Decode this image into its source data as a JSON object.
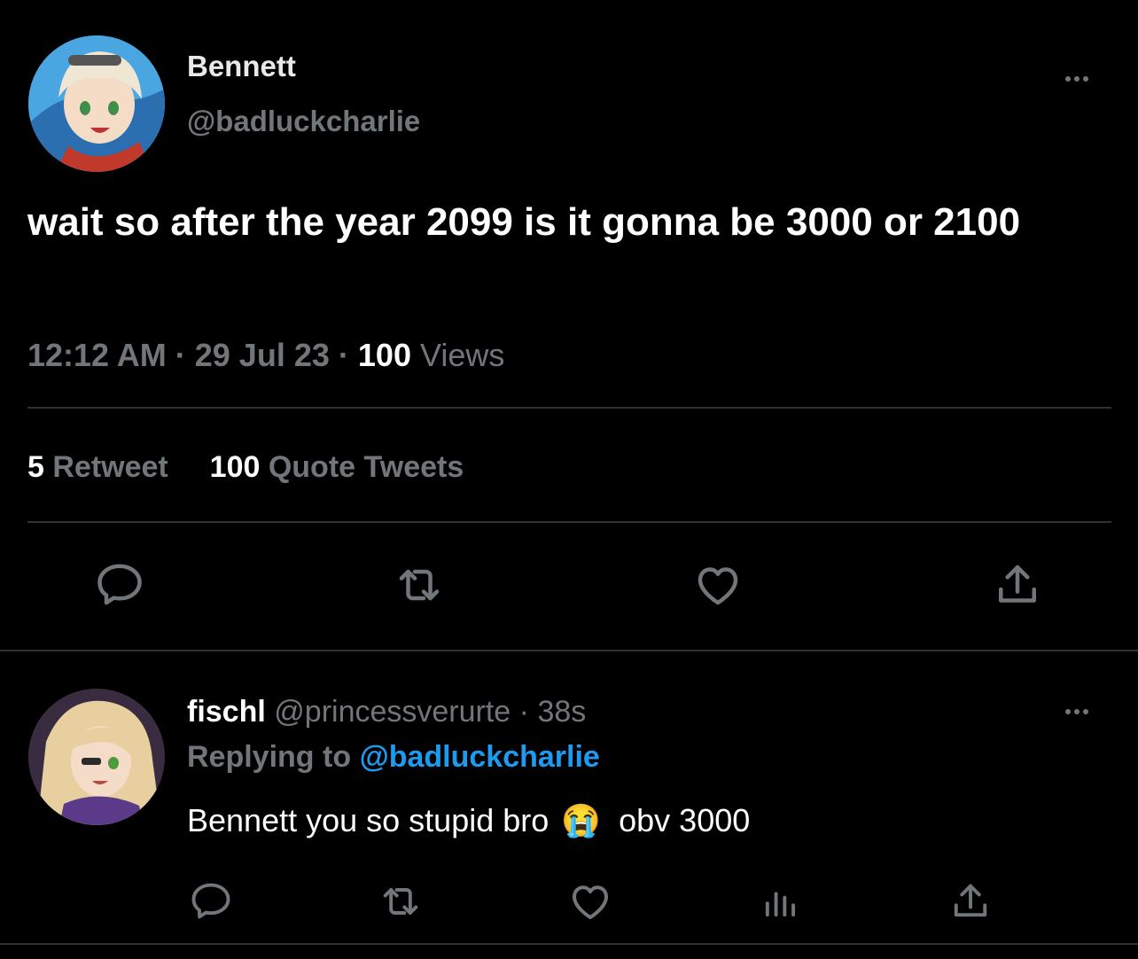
{
  "main_tweet": {
    "author_name": "Bennett",
    "author_handle": "@badluckcharlie",
    "text": "wait so after the year 2099 is it gonna be 3000 or 2100",
    "time": "12:12 AM",
    "date": "29 Jul 23",
    "separator": "·",
    "views_count": "100",
    "views_label": "Views",
    "retweets_count": "5",
    "retweets_label": "Retweet",
    "quotes_count": "100",
    "quotes_label": "Quote Tweets",
    "actions": [
      "reply-icon",
      "retweet-icon",
      "like-icon",
      "share-icon"
    ]
  },
  "reply": {
    "author_name": "fischl",
    "author_handle": "@princessverurte",
    "separator": "·",
    "time": "38s",
    "replying_prefix": "Replying to",
    "replying_to": "@badluckcharlie",
    "text_before_emoji": "Bennett you so stupid bro",
    "emoji": "😭",
    "text_after_emoji": "obv 3000",
    "actions": [
      "reply-icon",
      "retweet-icon",
      "like-icon",
      "analytics-icon",
      "share-icon"
    ]
  },
  "colors": {
    "background": "#000000",
    "text": "#e7e9ea",
    "muted": "#71767b",
    "link": "#1d9bf0",
    "divider": "#2f3336"
  }
}
